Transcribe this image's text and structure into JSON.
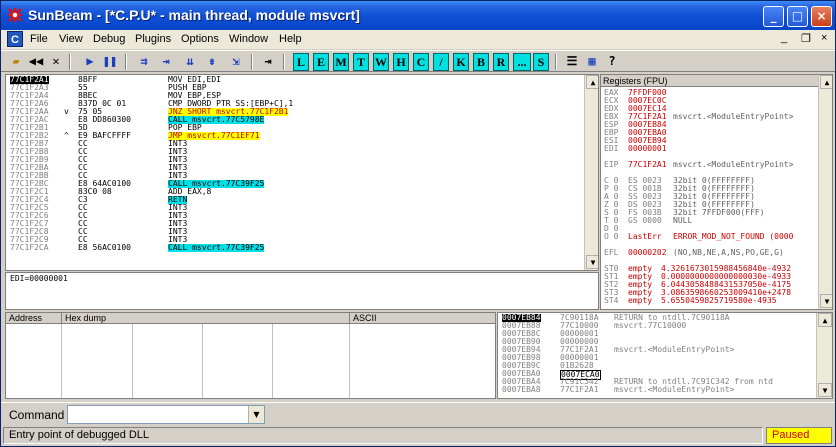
{
  "title": "SunBeam - [*C.P.U* - main thread, module msvcrt]",
  "menu": [
    "File",
    "View",
    "Debug",
    "Plugins",
    "Options",
    "Window",
    "Help"
  ],
  "menu_icon": "C",
  "mdi_controls": [
    "_",
    "❐",
    "×"
  ],
  "toolbar_letters": [
    "L",
    "E",
    "M",
    "T",
    "W",
    "H",
    "C",
    "/",
    "K",
    "B",
    "R",
    "...",
    "S"
  ],
  "icons": {
    "open": "open-folder-icon",
    "rewind": "rewind-icon",
    "close": "close-x-icon",
    "run": "run-icon",
    "pause": "pause-icon",
    "step_into": "step-into-icon",
    "step_over": "step-over-icon",
    "trace_into": "trace-into-icon",
    "trace_over": "trace-over-icon",
    "exec_till_return": "execute-till-return-icon",
    "goto": "goto-icon",
    "list": "list-icon",
    "grid": "grid-icon",
    "help": "help-icon"
  },
  "disasm": [
    [
      "77C1F2A1",
      "8BFF",
      "MOV EDI,EDI",
      "sel"
    ],
    [
      "77C1F2A3",
      "55",
      "PUSH EBP",
      ""
    ],
    [
      "77C1F2A4",
      "8BEC",
      "MOV EBP,ESP",
      ""
    ],
    [
      "77C1F2A6",
      "837D 0C 01",
      "CMP DWORD PTR SS:[EBP+C],1",
      ""
    ],
    [
      "77C1F2AA",
      "75 05",
      "JNZ SHORT msvcrt.77C1F2B1",
      "yel"
    ],
    [
      "77C1F2AC",
      "E8 DD860300",
      "CALL msvcrt.77C5798E",
      "cyan"
    ],
    [
      "77C1F2B1",
      "5D",
      "POP EBP",
      ""
    ],
    [
      "77C1F2B2",
      "E9 BAFCFFFF",
      "JMP msvcrt.77C1EF71",
      "yel"
    ],
    [
      "77C1F2B7",
      "CC",
      "INT3",
      ""
    ],
    [
      "77C1F2B8",
      "CC",
      "INT3",
      ""
    ],
    [
      "77C1F2B9",
      "CC",
      "INT3",
      ""
    ],
    [
      "77C1F2BA",
      "CC",
      "INT3",
      ""
    ],
    [
      "77C1F2BB",
      "CC",
      "INT3",
      ""
    ],
    [
      "77C1F2BC",
      "E8 64AC0100",
      "CALL msvcrt.77C39F25",
      "cyan"
    ],
    [
      "77C1F2C1",
      "83C0 08",
      "ADD EAX,8",
      ""
    ],
    [
      "77C1F2C4",
      "C3",
      "RETN",
      "cyan"
    ],
    [
      "77C1F2C5",
      "CC",
      "INT3",
      ""
    ],
    [
      "77C1F2C6",
      "CC",
      "INT3",
      ""
    ],
    [
      "77C1F2C7",
      "CC",
      "INT3",
      ""
    ],
    [
      "77C1F2C8",
      "CC",
      "INT3",
      ""
    ],
    [
      "77C1F2C9",
      "CC",
      "INT3",
      ""
    ],
    [
      "77C1F2CA",
      "E8 56AC0100",
      "CALL msvcrt.77C39F25",
      "cyan"
    ]
  ],
  "disasm_marks": {
    "4": "v",
    "7": "^"
  },
  "info_line": "EDI=00000001",
  "registers_title": "Registers (FPU)",
  "registers": [
    [
      "EAX",
      "7FFDF000",
      "",
      "red"
    ],
    [
      "ECX",
      "0007EC0C",
      "",
      "red"
    ],
    [
      "EDX",
      "0007EC14",
      "",
      "red"
    ],
    [
      "EBX",
      "77C1F2A1",
      "msvcrt.<ModuleEntryPoint>",
      "red"
    ],
    [
      "ESP",
      "0007EB84",
      "",
      "red"
    ],
    [
      "EBP",
      "0007EBA0",
      "",
      "red"
    ],
    [
      "ESI",
      "0007EB94",
      "",
      "red"
    ],
    [
      "EDI",
      "00000001",
      "",
      "red"
    ],
    [
      "",
      "",
      "",
      ""
    ],
    [
      "EIP",
      "77C1F2A1",
      "msvcrt.<ModuleEntryPoint>",
      "red"
    ],
    [
      "",
      "",
      "",
      ""
    ],
    [
      "C 0",
      "ES 0023",
      "32bit 0(FFFFFFFF)",
      ""
    ],
    [
      "P 0",
      "CS 001B",
      "32bit 0(FFFFFFFF)",
      ""
    ],
    [
      "A 0",
      "SS 0023",
      "32bit 0(FFFFFFFF)",
      ""
    ],
    [
      "Z 0",
      "DS 0023",
      "32bit 0(FFFFFFFF)",
      ""
    ],
    [
      "S 0",
      "FS 003B",
      "32bit 7FFDF000(FFF)",
      ""
    ],
    [
      "T 0",
      "GS 0000",
      "NULL",
      ""
    ],
    [
      "D 0",
      "",
      "",
      ""
    ],
    [
      "O 0",
      "LastErr",
      "ERROR_MOD_NOT_FOUND (0000",
      "red"
    ],
    [
      "",
      "",
      "",
      ""
    ],
    [
      "EFL",
      "00000202",
      "(NO,NB,NE,A,NS,PO,GE,G)",
      "red"
    ],
    [
      "",
      "",
      "",
      ""
    ],
    [
      "ST0",
      "empty",
      "4.3261673015988456840e-4932",
      "red"
    ],
    [
      "ST1",
      "empty",
      "0.0000000000000000030e-4933",
      "red"
    ],
    [
      "ST2",
      "empty",
      "6.0443058488431537050e-4175",
      "red"
    ],
    [
      "ST3",
      "empty",
      "3.0863598660253009410e+2478",
      "red"
    ],
    [
      "ST4",
      "empty",
      "5.6550459825719580e-4935",
      "red"
    ]
  ],
  "dump_headers": [
    "Address",
    "Hex dump",
    "ASCII"
  ],
  "stack": [
    [
      "0007EB84",
      "7C90118A",
      "RETURN to ntdll.7C90118A",
      "sel"
    ],
    [
      "0007EB88",
      "77C10000",
      "msvcrt.77C10000",
      ""
    ],
    [
      "0007EB8C",
      "00000001",
      "",
      ""
    ],
    [
      "0007EB90",
      "00000000",
      "",
      ""
    ],
    [
      "0007EB94",
      "77C1F2A1",
      "msvcrt.<ModuleEntryPoint>",
      ""
    ],
    [
      "0007EB98",
      "00000001",
      "",
      ""
    ],
    [
      "0007EB9C",
      "01B2628",
      "",
      ""
    ],
    [
      "0007EBA0",
      "0007ECA0",
      "",
      "box"
    ],
    [
      "0007EBA4",
      "7C91C342",
      "RETURN to ntdll.7C91C342 from ntd",
      ""
    ],
    [
      "0007EBA8",
      "77C1F2A1",
      "msvcrt.<ModuleEntryPoint>",
      ""
    ]
  ],
  "command_label": "Command",
  "command_value": "",
  "status_text": "Entry point of debugged DLL",
  "status_state": "Paused",
  "colors": {
    "accent": "#0a246a",
    "highlight_yellow": "#ffff00",
    "highlight_cyan": "#00e0e8",
    "paused": "#ffff00"
  }
}
